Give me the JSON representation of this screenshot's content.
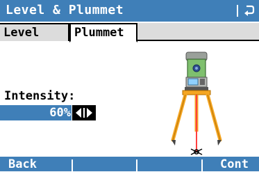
{
  "window": {
    "title": "Level & Plummet"
  },
  "tabs": [
    {
      "label": "Level",
      "active": false
    },
    {
      "label": "Plummet",
      "active": true
    }
  ],
  "intensity": {
    "label": "Intensity:",
    "value": "60%"
  },
  "softkeys": {
    "back": "Back",
    "cont": "Cont"
  },
  "colors": {
    "accent": "#3f7fb8",
    "tab_inactive": "#dcdcdc",
    "tripod": "#f5a623",
    "plummet": "#ff4040"
  },
  "icons": {
    "back": "return-arrow-icon",
    "stepper": "left-right-arrows-icon",
    "illustration": "total-station-tripod"
  }
}
